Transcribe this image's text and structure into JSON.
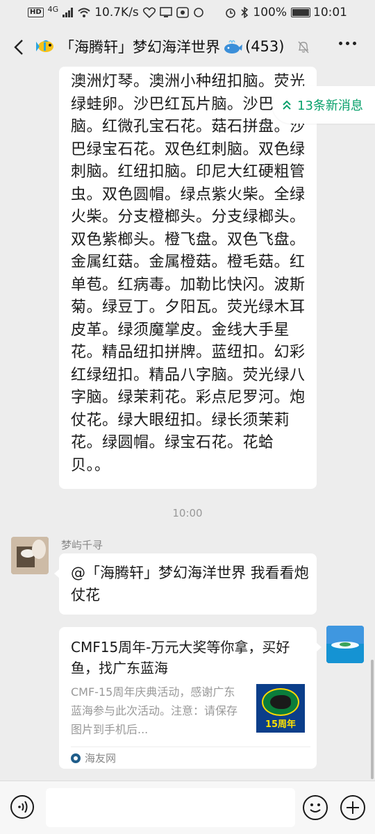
{
  "status_bar": {
    "network_speed": "10.7K/s",
    "battery": "100%",
    "battery_level": 1.0,
    "time": "10:01",
    "hd_label": "HD",
    "signal_label": "4G"
  },
  "header": {
    "title": "「海腾轩」梦幻海洋世界",
    "member_count": "(453)",
    "icons": [
      "back-icon",
      "fish-emoji",
      "whale-emoji",
      "mute-bell-icon",
      "more-icon"
    ]
  },
  "new_messages": {
    "label": "13条新消息",
    "icon": "double-chevron-up-icon",
    "color": "#07a06b"
  },
  "messages": {
    "long_text": "澳洲灯琴。澳洲小种纽扣脑。荧光绿蛙卵。沙巴红瓦片脑。沙巴河谷脑。红微孔宝石花。菇石拼盘。沙巴绿宝石花。双色红刺脑。双色绿刺脑。红纽扣脑。印尼大红硬粗管虫。双色圆帽。绿点紫火柴。全绿火柴。分支橙榔头。分支绿榔头。双色紫榔头。橙飞盘。双色飞盘。金属红菇。金属橙菇。橙毛菇。红单苞。红病毒。加勒比快闪。波斯菊。绿豆丁。夕阳瓦。荧光绿木耳皮革。绿须魔掌皮。金线大手星花。精品纽扣拼牌。蓝纽扣。幻彩红绿纽扣。精品八字脑。荧光绿八字脑。绿茉莉花。彩点尼罗河。炮仗花。绿大眼纽扣。绿长须茉莉花。绿圆帽。绿宝石花。花蛤贝。。",
    "timestamp": "10:00",
    "reply": {
      "sender": "梦屿千寻",
      "text": "@「海腾轩」梦幻海洋世界  我看看炮仗花"
    },
    "card": {
      "title": "CMF15周年-万元大奖等你拿，买好鱼，找广东蓝海",
      "description": "CMF-15周年庆典活动，感谢广东蓝海参与此次活动。注意：请保存图片到手机后...",
      "thumb_label": "15周年",
      "source": "海友网"
    }
  },
  "input_bar": {
    "placeholder": "",
    "icons": [
      "voice-icon",
      "emoji-icon",
      "plus-icon"
    ]
  }
}
